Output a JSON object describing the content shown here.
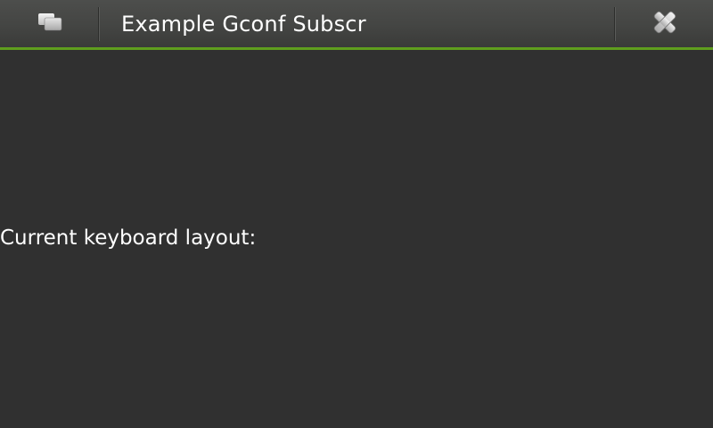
{
  "window": {
    "title": "Example Gconf Subscr",
    "accent_color": "#5f9e1e",
    "background_color": "#303030"
  },
  "title_bar": {
    "task_switcher_icon": "task-switcher-icon",
    "close_icon": "close-icon"
  },
  "content": {
    "keyboard_layout_label": "Current keyboard layout:"
  }
}
